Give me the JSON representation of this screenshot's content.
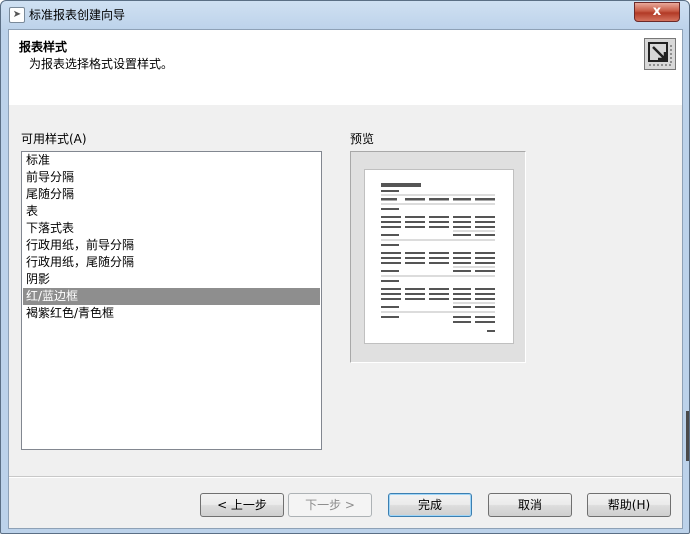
{
  "window": {
    "title": "标准报表创建向导",
    "close_label": "x"
  },
  "header": {
    "title": "报表样式",
    "subtitle": "为报表选择格式设置样式。"
  },
  "styles": {
    "label": "可用样式(A)",
    "items": [
      "标准",
      "前导分隔",
      "尾随分隔",
      "表",
      "下落式表",
      "行政用纸，前导分隔",
      "行政用纸，尾随分隔",
      "阴影",
      "红/蓝边框",
      "褐紫红色/青色框"
    ],
    "selected_index": 8
  },
  "preview": {
    "label": "预览"
  },
  "buttons": {
    "back": "< 上一步",
    "next": "下一步 >",
    "finish": "完成",
    "cancel": "取消",
    "help": "帮助(H)"
  }
}
